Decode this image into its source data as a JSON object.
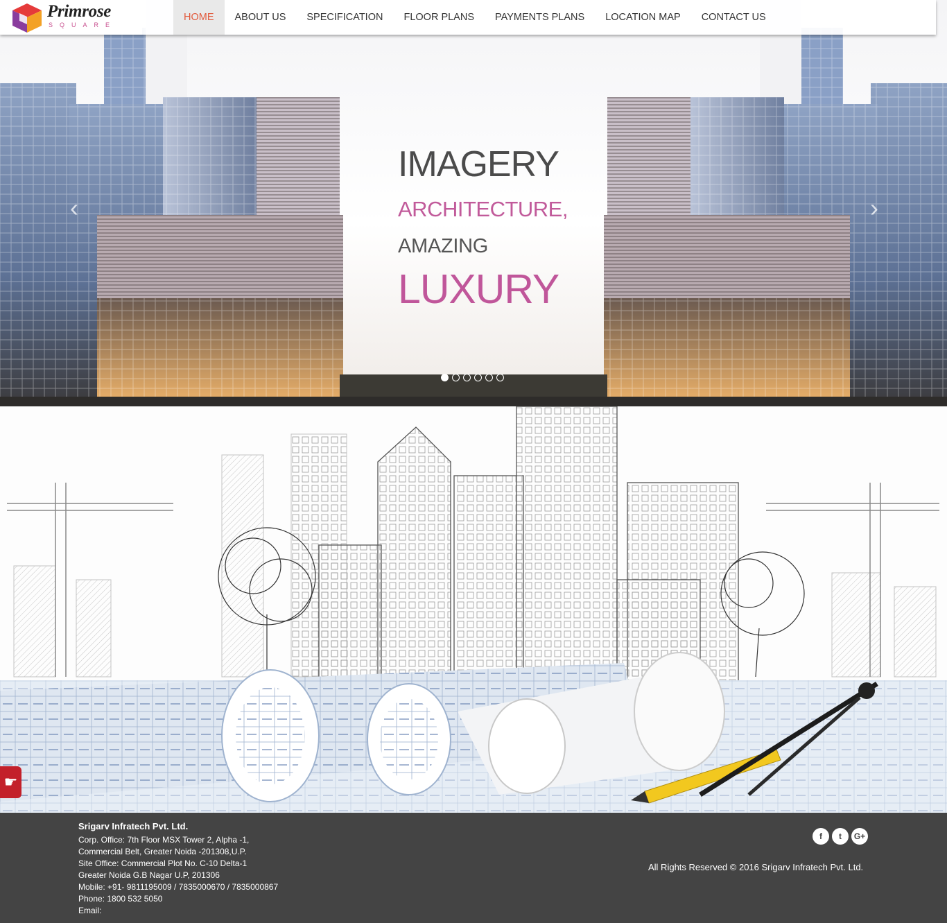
{
  "brand": {
    "name": "Primrose",
    "sub": "SQUARE"
  },
  "nav": {
    "items": [
      "HOME",
      "ABOUT US",
      "SPECIFICATION",
      "FLOOR PLANS",
      "PAYMENTS PLANS",
      "LOCATION MAP",
      "CONTACT US"
    ],
    "active_index": 0
  },
  "hero": {
    "lines": [
      "IMAGERY",
      "ARCHITECTURE,",
      "AMAZING",
      "LUXURY"
    ],
    "prev_icon": "chevron-left-icon",
    "next_icon": "chevron-right-icon",
    "slide_count": 6,
    "active_slide": 1
  },
  "side_tab": {
    "icon": "hand-pointer-icon",
    "color": "#c3202a"
  },
  "footer": {
    "company": "Srigarv Infratech Pvt. Ltd.",
    "address_lines": [
      "Corp. Office: 7th Floor MSX Tower 2, Alpha -1,",
      "Commercial Belt, Greater Noida -201308,U.P.",
      "Site Office: Commercial Plot No. C-10 Delta-1",
      "Greater Noida G.B Nagar U.P, 201306",
      "Mobile: +91- 9811195009 / 7835000670 / 7835000867",
      "Phone: 1800 532 5050",
      "Email:"
    ],
    "copyright": "All Rights Reserved © 2016 Srigarv Infratech Pvt. Ltd.",
    "social": [
      {
        "icon": "facebook-icon",
        "glyph": "f"
      },
      {
        "icon": "twitter-icon",
        "glyph": "t"
      },
      {
        "icon": "google-plus-icon",
        "glyph": "G+"
      }
    ]
  },
  "colors": {
    "accent": "#e25a3c",
    "pink": "#c0569a",
    "footer_bg": "#444444"
  }
}
